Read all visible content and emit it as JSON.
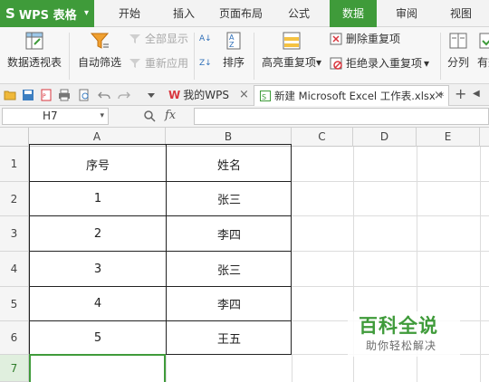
{
  "app": {
    "name": "WPS 表格",
    "logo_mark": "S"
  },
  "menu": {
    "tabs": [
      "开始",
      "插入",
      "页面布局",
      "公式",
      "数据",
      "审阅",
      "视图"
    ],
    "active": "数据"
  },
  "ribbon": {
    "pivot_table": "数据透视表",
    "auto_filter": "自动筛选",
    "show_all": "全部显示",
    "reapply": "重新应用",
    "sort": "排序",
    "highlight_duplicates": "高亮重复项",
    "highlight_caret": "▾",
    "remove_duplicates": "删除重复项",
    "reject_duplicates": "拒绝录入重复项",
    "reject_caret": "▾",
    "split": "分列",
    "valid_partial": "有效"
  },
  "docbar": {
    "tab1": "我的WPS",
    "tab2": "新建 Microsoft Excel 工作表.xlsx *",
    "close": "×",
    "new_tab": "+"
  },
  "formula_bar": {
    "name_box": "H7",
    "fx": "fx",
    "formula": ""
  },
  "sheet": {
    "columns": [
      "A",
      "B",
      "C",
      "D",
      "E"
    ],
    "rows": [
      "1",
      "2",
      "3",
      "4",
      "5",
      "6",
      "7"
    ],
    "active_row": "7",
    "cells": [
      [
        "序号",
        "姓名"
      ],
      [
        "1",
        "张三"
      ],
      [
        "2",
        "李四"
      ],
      [
        "3",
        "张三"
      ],
      [
        "4",
        "李四"
      ],
      [
        "5",
        "王五"
      ]
    ]
  },
  "watermark": {
    "title": "百科全说",
    "subtitle": "助你轻松解决"
  },
  "colors": {
    "accent": "#3f9b3a",
    "logo_red": "#d9363e"
  }
}
